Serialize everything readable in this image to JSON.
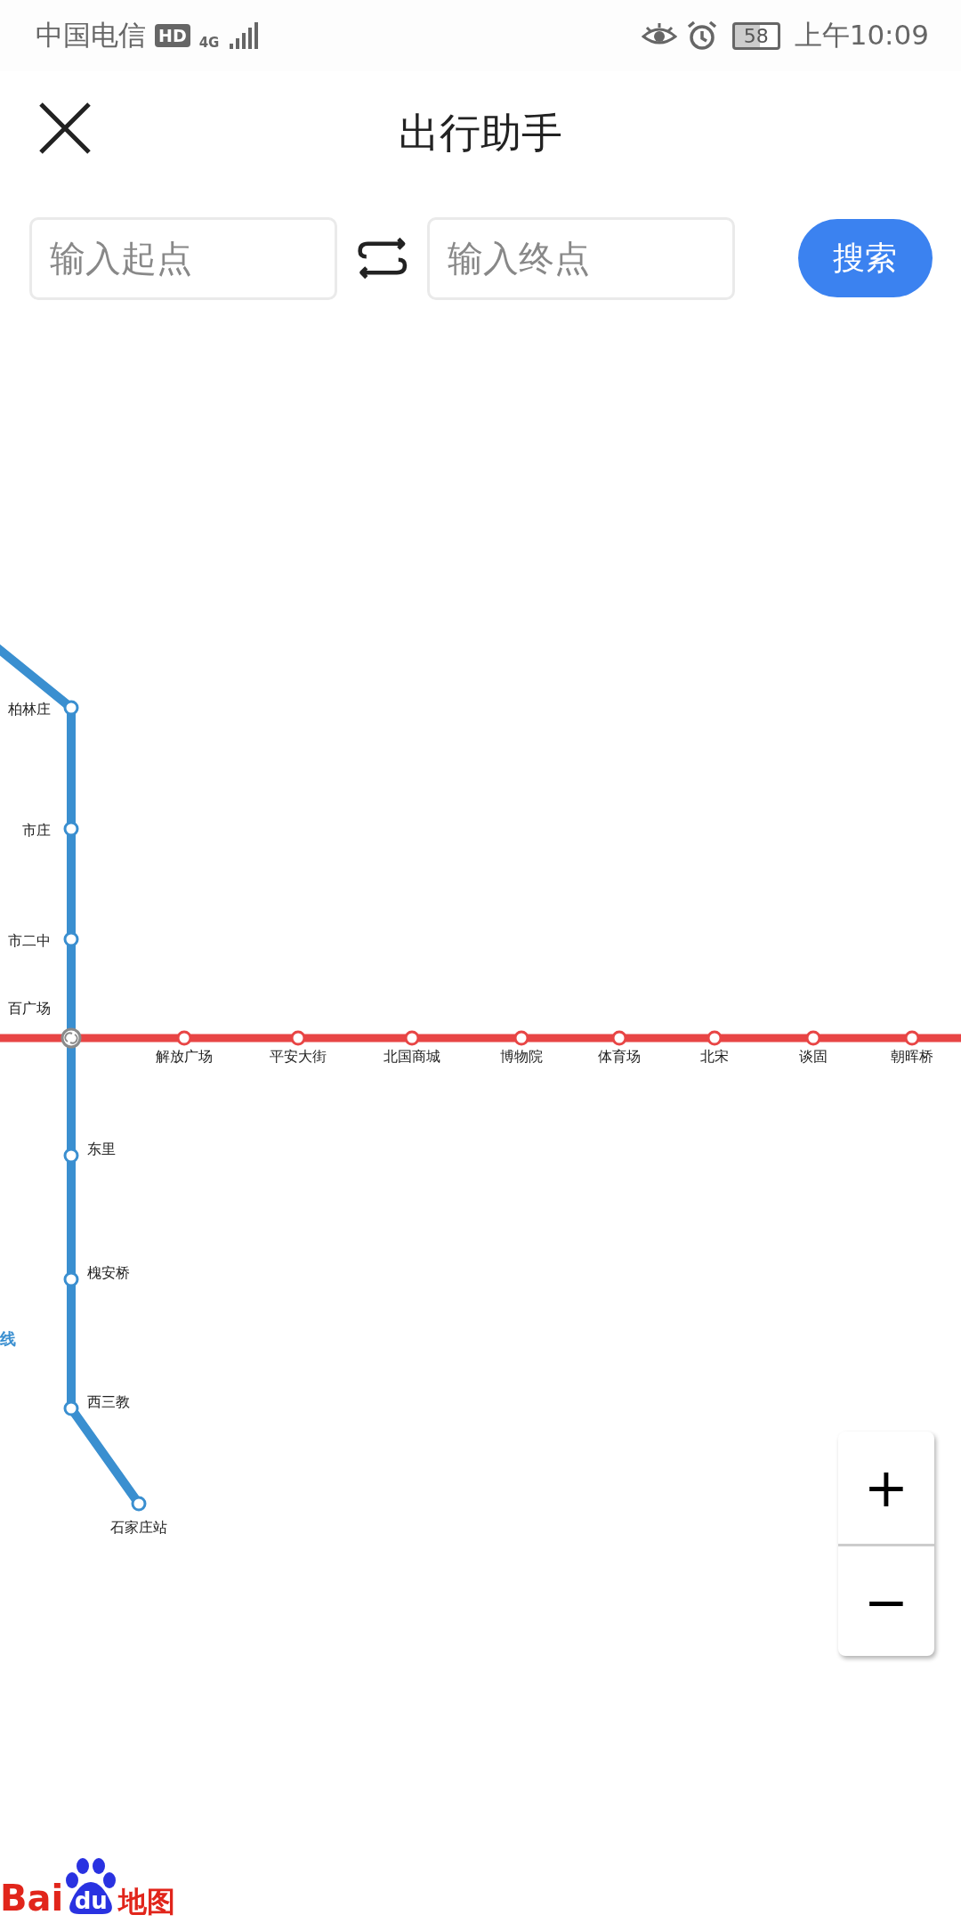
{
  "status_bar": {
    "carrier": "中国电信",
    "badge": "HD",
    "network": "4G",
    "battery": "58",
    "time": "上午10:09"
  },
  "header": {
    "title": "出行助手"
  },
  "search": {
    "start_placeholder": "输入起点",
    "end_placeholder": "输入终点",
    "button": "搜索"
  },
  "map": {
    "lines": [
      {
        "label": "线",
        "color": "#3a8fd0",
        "stations": [
          {
            "name": "柏林庄",
            "kind": "normal"
          },
          {
            "name": "市庄",
            "kind": "normal"
          },
          {
            "name": "市二中",
            "kind": "normal"
          },
          {
            "name": "百广场",
            "kind": "interchange"
          },
          {
            "name": "东里",
            "kind": "normal"
          },
          {
            "name": "槐安桥",
            "kind": "normal"
          },
          {
            "name": "西三教",
            "kind": "normal"
          },
          {
            "name": "石家庄站",
            "kind": "normal"
          }
        ]
      },
      {
        "color": "#e84545",
        "stations": [
          {
            "name": "解放广场",
            "kind": "normal"
          },
          {
            "name": "平安大街",
            "kind": "normal"
          },
          {
            "name": "北国商城",
            "kind": "normal"
          },
          {
            "name": "博物院",
            "kind": "normal"
          },
          {
            "name": "体育场",
            "kind": "normal"
          },
          {
            "name": "北宋",
            "kind": "normal"
          },
          {
            "name": "谈固",
            "kind": "normal"
          },
          {
            "name": "朝晖桥",
            "kind": "normal"
          }
        ]
      }
    ],
    "zoom_in": "+",
    "zoom_out": "−",
    "logo": {
      "part_1": "Bai",
      "part_2": "du",
      "part_3": "地图"
    }
  }
}
